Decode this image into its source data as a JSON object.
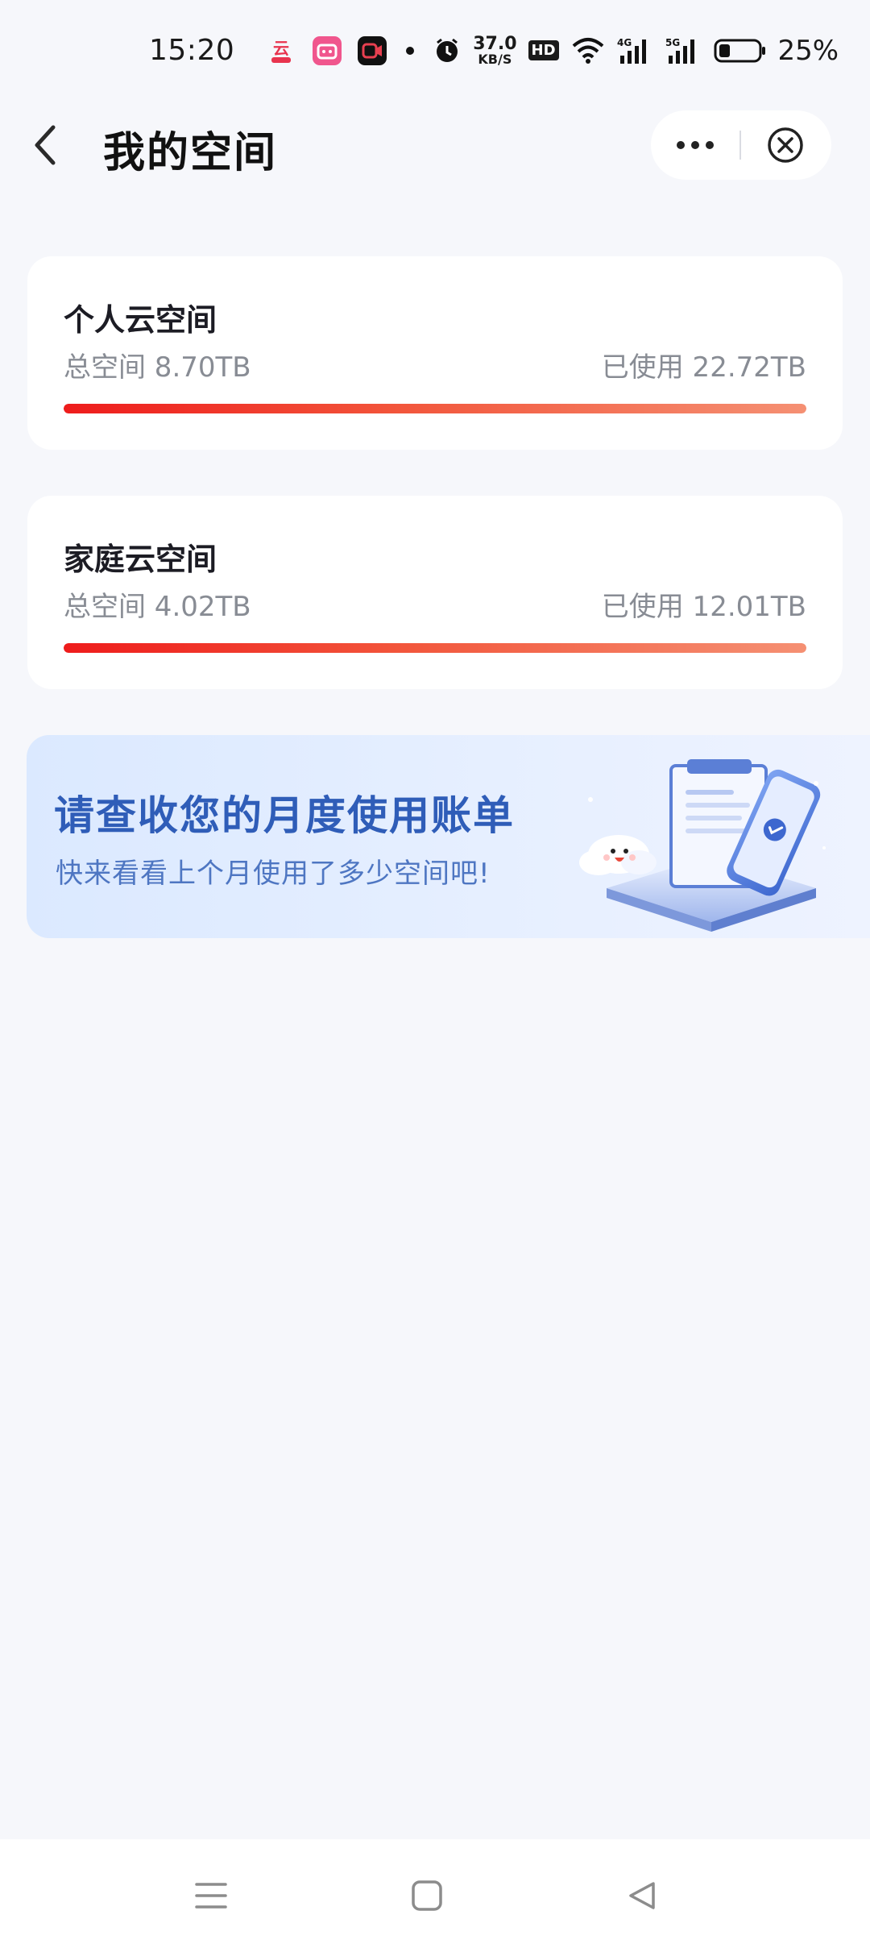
{
  "status_bar": {
    "time": "15:20",
    "net_speed_value": "37.0",
    "net_speed_unit": "KB/S",
    "hd_label": "HD",
    "signal_1": "4G",
    "signal_2": "5G",
    "battery": "25%",
    "icons": [
      "cloud-app-icon",
      "bilibili-icon",
      "video-recorder-icon",
      "notification-dot-icon",
      "alarm-icon",
      "wifi-icon",
      "signal-icon",
      "battery-icon"
    ]
  },
  "header": {
    "title": "我的空间",
    "back_icon": "chevron-left-icon",
    "more_icon": "more-dots-icon",
    "close_icon": "close-circle-icon"
  },
  "cards": [
    {
      "title": "个人云空间",
      "total_label": "总空间  8.70TB",
      "used_label": "已使用  22.72TB",
      "usage_fraction": 1.0
    },
    {
      "title": "家庭云空间",
      "total_label": "总空间  4.02TB",
      "used_label": "已使用  12.01TB",
      "usage_fraction": 1.0
    }
  ],
  "banner": {
    "title": "请查收您的月度使用账单",
    "subtitle": "快来看看上个月使用了多少空间吧!",
    "art_icon": "bill-phone-cloud-illustration"
  },
  "colors": {
    "accent_blue": "#2f5db8",
    "bar_start": "#ee1c1c",
    "bar_end": "#f59073",
    "background": "#f6f7fb"
  },
  "nav_bar": {
    "icons": [
      "menu-icon",
      "home-square-icon",
      "back-triangle-icon"
    ]
  }
}
